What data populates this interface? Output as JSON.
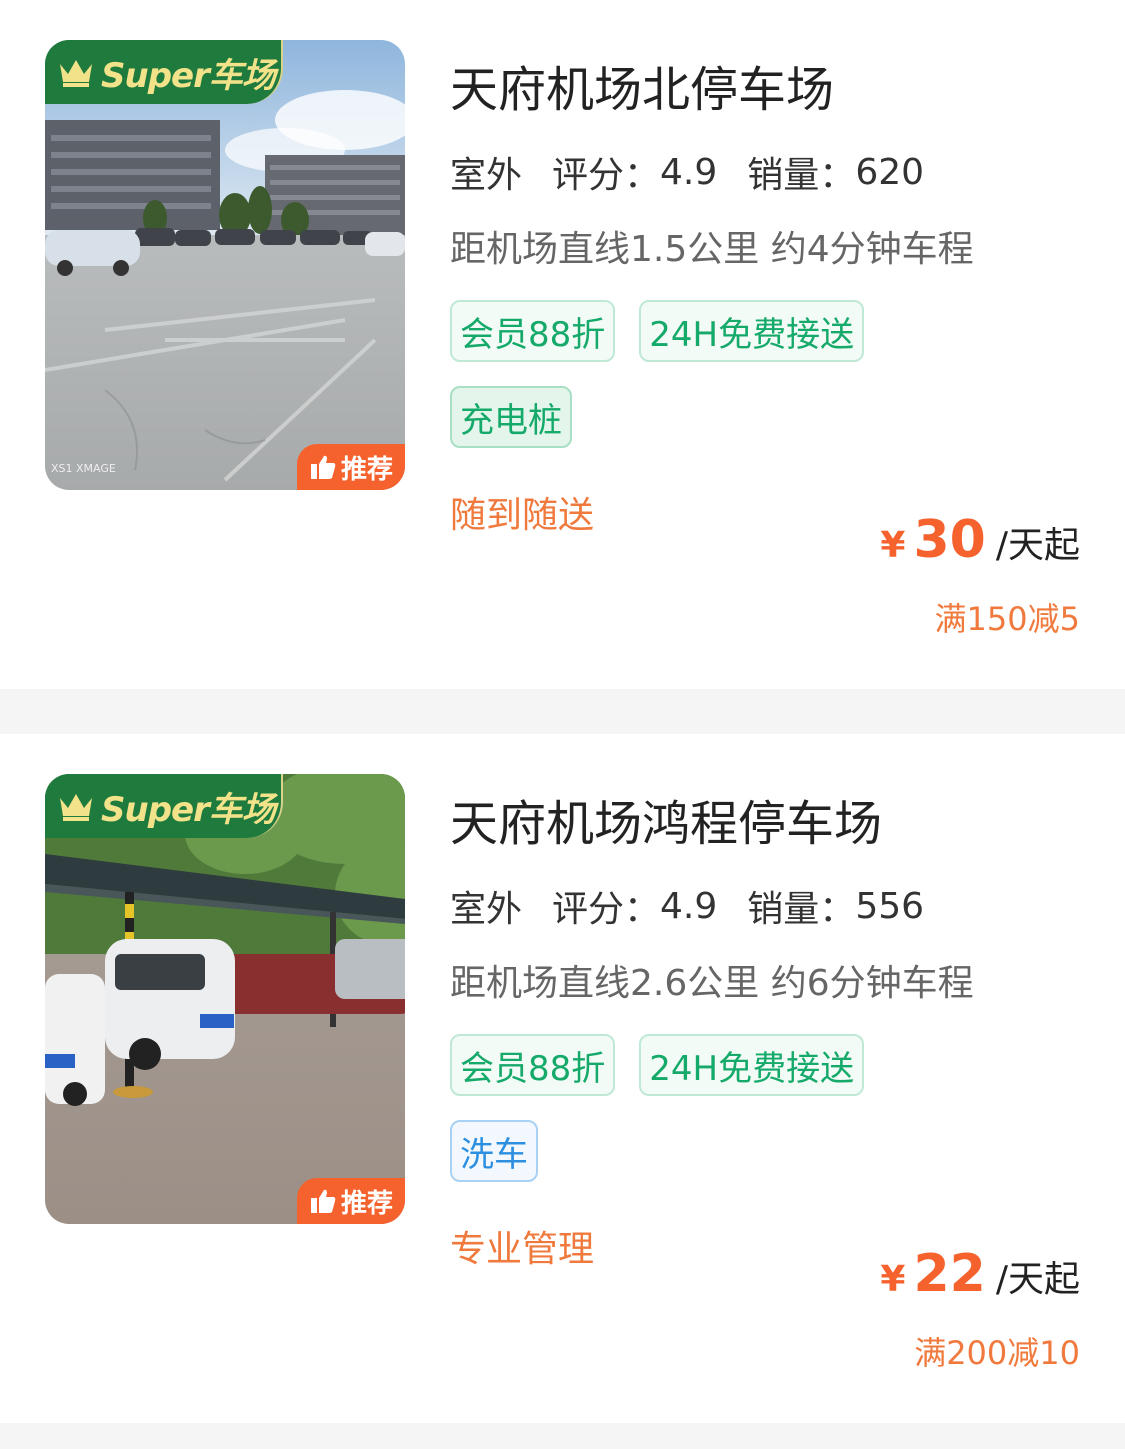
{
  "lots": [
    {
      "badge_label": "Super车场",
      "recommend_label": "推荐",
      "name": "天府机场北停车场",
      "env": "室外",
      "rating_label": "评分：",
      "rating": "4.9",
      "sales_label": "销量：",
      "sales": "620",
      "distance": "距机场直线1.5公里 约4分钟车程",
      "tags": [
        {
          "label": "会员88折",
          "style": "green"
        },
        {
          "label": "24H免费接送",
          "style": "green"
        },
        {
          "label": "充电桩",
          "style": "green-fill"
        }
      ],
      "slogan": "随到随送",
      "currency": "¥",
      "price": "30",
      "price_unit": "/天起",
      "discount": "满150减5",
      "photo_watermark": "XS1 XMAGE"
    },
    {
      "badge_label": "Super车场",
      "recommend_label": "推荐",
      "name": "天府机场鸿程停车场",
      "env": "室外",
      "rating_label": "评分：",
      "rating": "4.9",
      "sales_label": "销量：",
      "sales": "556",
      "distance": "距机场直线2.6公里 约6分钟车程",
      "tags": [
        {
          "label": "会员88折",
          "style": "green"
        },
        {
          "label": "24H免费接送",
          "style": "green"
        },
        {
          "label": "洗车",
          "style": "blue"
        }
      ],
      "slogan": "专业管理",
      "currency": "¥",
      "price": "22",
      "price_unit": "/天起",
      "discount": "满200减10"
    }
  ],
  "colors": {
    "brand_green": "#1f7a3d",
    "badge_gold": "#f2e38a",
    "accent_orange": "#f5622d",
    "tag_green": "#15a96a",
    "tag_blue": "#2d8fe0"
  },
  "icons": [
    "crown-icon",
    "thumbs-up-icon"
  ]
}
